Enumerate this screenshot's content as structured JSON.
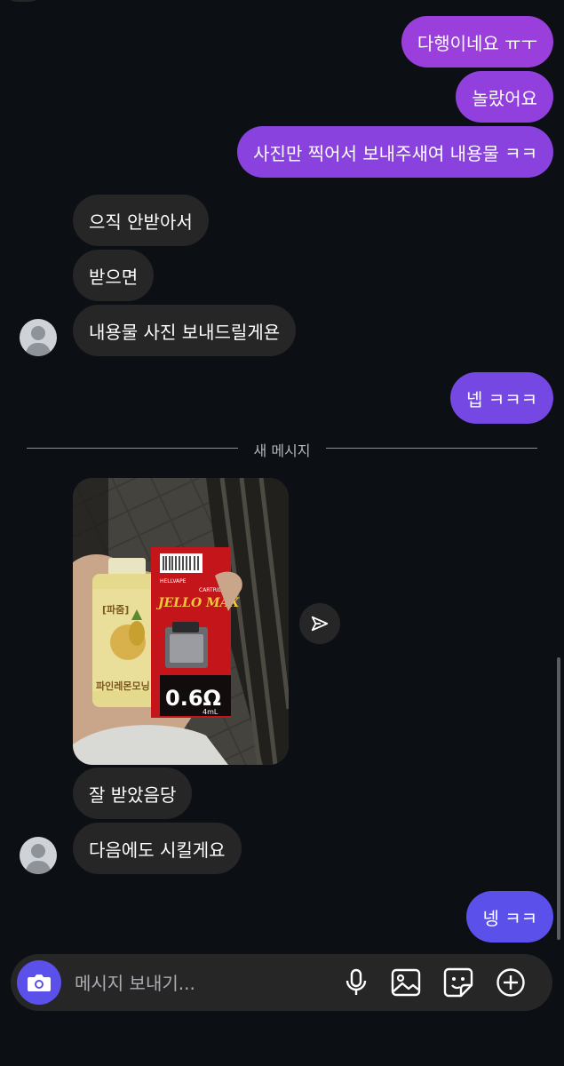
{
  "chat": {
    "messages": [
      {
        "id": "m1",
        "side": "out",
        "text": "다행이네요 ㅠㅜ"
      },
      {
        "id": "m2",
        "side": "out",
        "text": "놀랐어요"
      },
      {
        "id": "m3",
        "side": "out",
        "text": "사진만 찍어서 보내주새여 내용물 ㅋㅋ"
      },
      {
        "id": "m4",
        "side": "in",
        "text": "으직 안받아서"
      },
      {
        "id": "m5",
        "side": "in",
        "text": "받으면"
      },
      {
        "id": "m6",
        "side": "in",
        "text": "내용물 사진 보내드릴게욘"
      },
      {
        "id": "m7",
        "side": "out",
        "text": "넵 ㅋㅋㅋ"
      },
      {
        "id": "m8",
        "side": "in",
        "text": "잘 받았음당"
      },
      {
        "id": "m9",
        "side": "in",
        "text": "다음에도 시킬게요"
      },
      {
        "id": "m10",
        "side": "out",
        "text": "넹 ㅋㅋ"
      }
    ],
    "new_messages_divider": "새 메시지",
    "photo": {
      "bottle_label": "[파줌]",
      "bottle_text": "파인레몬모닝",
      "box_brand": "JELLO MAX",
      "box_tag": "CARTRIDGE",
      "box_maker": "HELLVAPE",
      "resistance": "0.6Ω",
      "volume": "4mL"
    }
  },
  "composer": {
    "placeholder": "메시지 보내기..."
  },
  "icons": {
    "camera": "camera-icon",
    "share": "send-icon",
    "mic": "microphone-icon",
    "gallery": "image-icon",
    "sticker": "sticker-icon",
    "plus": "plus-circle-icon",
    "avatar": "default-avatar-icon"
  },
  "colors": {
    "background": "#0c0f14",
    "incoming_bubble": "#262626",
    "outgoing_gradient": [
      "#a43fd9",
      "#5b51ea"
    ],
    "camera_button": "#5b51ea"
  }
}
